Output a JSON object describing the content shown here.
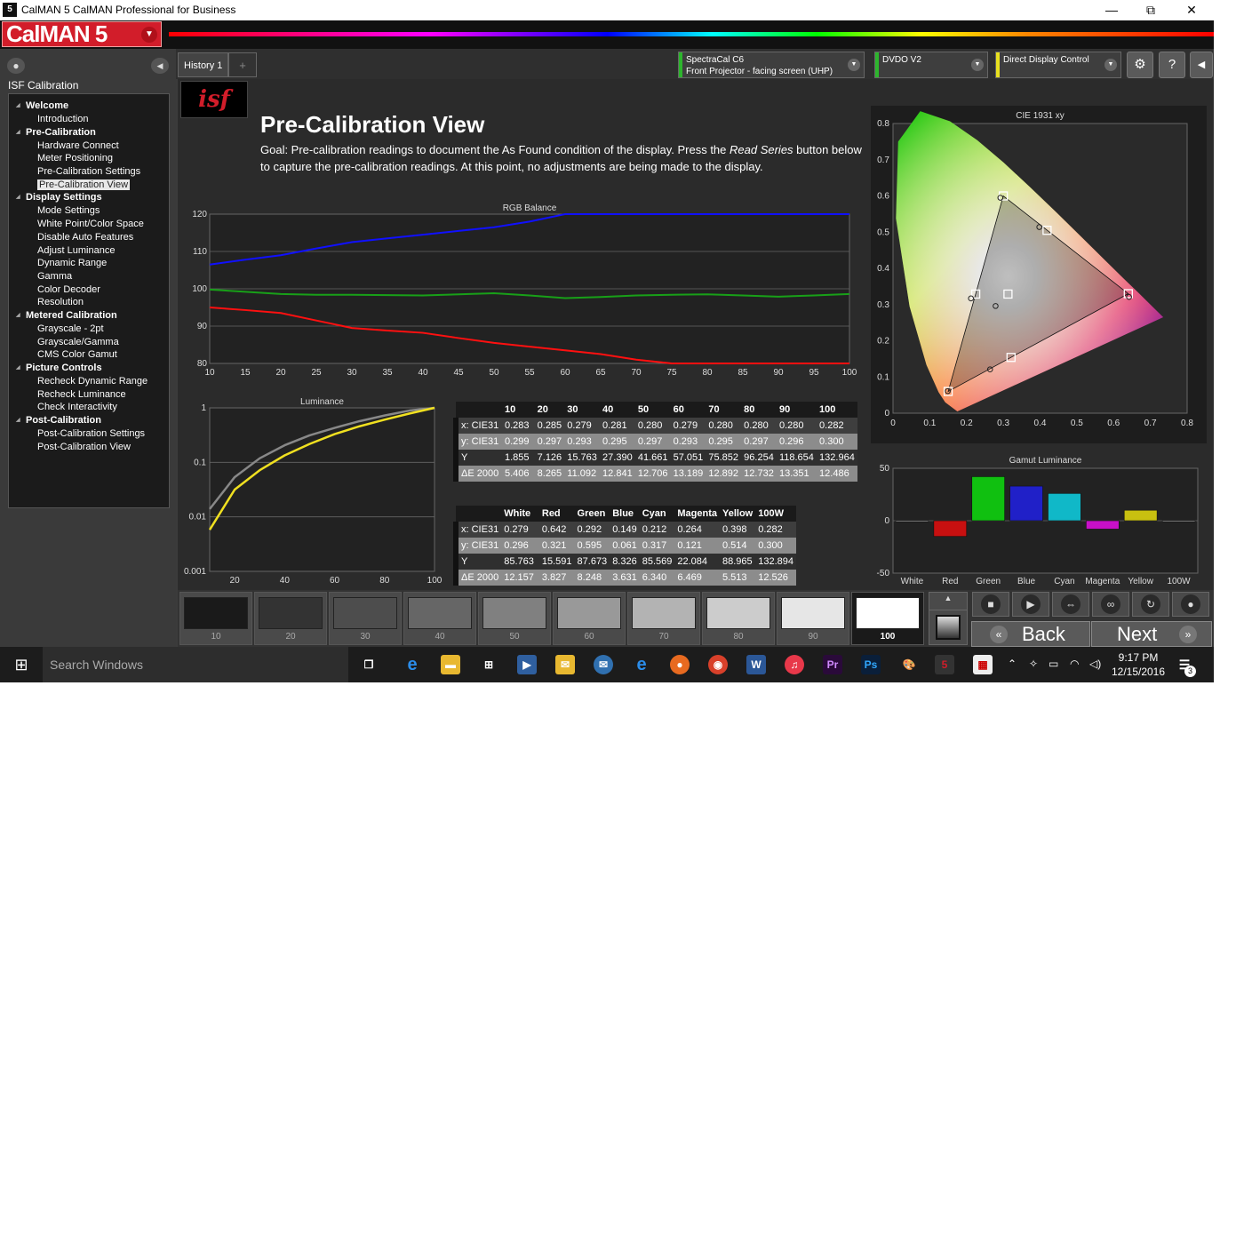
{
  "window": {
    "title": "CalMAN 5 CalMAN Professional for Business",
    "minimize": "—",
    "restore": "⧉",
    "close": "✕"
  },
  "brand": {
    "logo": "CalMAN 5"
  },
  "sidebar": {
    "workflow_title": "ISF Calibration",
    "groups": [
      {
        "label": "Welcome",
        "items": [
          "Introduction"
        ]
      },
      {
        "label": "Pre-Calibration",
        "items": [
          "Hardware Connect",
          "Meter Positioning",
          "Pre-Calibration Settings",
          "Pre-Calibration View"
        ]
      },
      {
        "label": "Display Settings",
        "items": [
          "Mode Settings",
          "White Point/Color Space",
          "Disable Auto Features",
          "Adjust Luminance",
          "Dynamic Range",
          "Gamma",
          "Color Decoder",
          "Resolution"
        ]
      },
      {
        "label": "Metered Calibration",
        "items": [
          "Grayscale - 2pt",
          "Grayscale/Gamma",
          "CMS Color Gamut"
        ]
      },
      {
        "label": "Picture Controls",
        "items": [
          "Recheck Dynamic Range",
          "Recheck Luminance",
          "Check Interactivity"
        ]
      },
      {
        "label": "Post-Calibration",
        "items": [
          "Post-Calibration Settings",
          "Post-Calibration View"
        ]
      }
    ],
    "selected": "Pre-Calibration View"
  },
  "tabs": {
    "history": "History 1",
    "add": "+"
  },
  "devices": {
    "meter": {
      "line1": "SpectraCal C6",
      "line2": "Front Projector - facing screen (UHP)",
      "color": "#2db52d"
    },
    "source": {
      "line1": "DVDO V2",
      "color": "#2db52d"
    },
    "display": {
      "line1": "Direct Display Control",
      "color": "#e8e020"
    }
  },
  "toolbar": {
    "settings": "⚙",
    "help": "?",
    "collapse": "◀"
  },
  "page": {
    "logo": "isf",
    "title": "Pre-Calibration View",
    "goal_before": "Goal: Pre-calibration readings to document the As Found condition of the display. Press the ",
    "goal_em": "Read Series",
    "goal_after": " button below to capture the pre-calibration readings. At this point, no adjustments are being made to the display."
  },
  "grayscale_table": {
    "headers": [
      "",
      "10",
      "20",
      "30",
      "40",
      "50",
      "60",
      "70",
      "80",
      "90",
      "100"
    ],
    "rows": [
      {
        "label": "x: CIE31",
        "values": [
          "0.283",
          "0.285",
          "0.279",
          "0.281",
          "0.280",
          "0.279",
          "0.280",
          "0.280",
          "0.280",
          "0.282"
        ]
      },
      {
        "label": "y: CIE31",
        "values": [
          "0.299",
          "0.297",
          "0.293",
          "0.295",
          "0.297",
          "0.293",
          "0.295",
          "0.297",
          "0.296",
          "0.300"
        ]
      },
      {
        "label": "Y",
        "values": [
          "1.855",
          "7.126",
          "15.763",
          "27.390",
          "41.661",
          "57.051",
          "75.852",
          "96.254",
          "118.654",
          "132.964"
        ]
      },
      {
        "label": "ΔE 2000",
        "values": [
          "5.406",
          "8.265",
          "11.092",
          "12.841",
          "12.706",
          "13.189",
          "12.892",
          "12.732",
          "13.351",
          "12.486"
        ]
      }
    ]
  },
  "color_table": {
    "headers": [
      "",
      "White",
      "Red",
      "Green",
      "Blue",
      "Cyan",
      "Magenta",
      "Yellow",
      "100W"
    ],
    "rows": [
      {
        "label": "x: CIE31",
        "values": [
          "0.279",
          "0.642",
          "0.292",
          "0.149",
          "0.212",
          "0.264",
          "0.398",
          "0.282"
        ]
      },
      {
        "label": "y: CIE31",
        "values": [
          "0.296",
          "0.321",
          "0.595",
          "0.061",
          "0.317",
          "0.121",
          "0.514",
          "0.300"
        ]
      },
      {
        "label": "Y",
        "values": [
          "85.763",
          "15.591",
          "87.673",
          "8.326",
          "85.569",
          "22.084",
          "88.965",
          "132.894"
        ]
      },
      {
        "label": "ΔE 2000",
        "values": [
          "12.157",
          "3.827",
          "8.248",
          "3.631",
          "6.340",
          "6.469",
          "5.513",
          "12.526"
        ]
      }
    ]
  },
  "chart_data": [
    {
      "type": "line",
      "title": "RGB Balance",
      "x": [
        10,
        15,
        20,
        25,
        30,
        35,
        40,
        45,
        50,
        55,
        60,
        65,
        70,
        75,
        80,
        85,
        90,
        95,
        100
      ],
      "xlim": [
        10,
        100
      ],
      "ylim": [
        80,
        120
      ],
      "yticks": [
        80,
        90,
        100,
        110,
        120
      ],
      "series": [
        {
          "color": "#1010ff",
          "values": [
            106.5,
            107.8,
            109,
            110.8,
            112.5,
            113.5,
            114.5,
            115.5,
            116.5,
            118,
            120,
            120,
            120,
            120,
            120,
            120,
            120,
            120,
            120
          ]
        },
        {
          "color": "#18a018",
          "values": [
            99.8,
            99.2,
            98.6,
            98.4,
            98.4,
            98.3,
            98.2,
            98.5,
            98.8,
            98.2,
            97.5,
            97.8,
            98.2,
            98.4,
            98.5,
            98.2,
            97.9,
            98.2,
            98.6
          ]
        },
        {
          "color": "#ff1010",
          "values": [
            95,
            94.3,
            93.5,
            91.5,
            89.5,
            88.8,
            88.2,
            86.8,
            85.5,
            84.5,
            83.5,
            82.5,
            81,
            80,
            80,
            80,
            80,
            80,
            80
          ]
        }
      ]
    },
    {
      "type": "line",
      "title": "Luminance",
      "scale": "log",
      "x": [
        10,
        20,
        30,
        40,
        50,
        60,
        70,
        80,
        90,
        100
      ],
      "xlim": [
        10,
        100
      ],
      "xticks": [
        20,
        40,
        60,
        80,
        100
      ],
      "ylim": [
        0.001,
        1
      ],
      "yticks": [
        "1",
        "0.1",
        "0.01",
        "0.001"
      ],
      "series": [
        {
          "color": "#888888",
          "values": [
            0.0139,
            0.0536,
            0.1185,
            0.206,
            0.313,
            0.429,
            0.57,
            0.724,
            0.892,
            1.0
          ]
        },
        {
          "color": "#f0e020",
          "values": [
            0.0058,
            0.0316,
            0.0716,
            0.1342,
            0.2176,
            0.3297,
            0.4591,
            0.6062,
            0.7875,
            1.0
          ]
        }
      ]
    },
    {
      "type": "scatter",
      "title": "CIE 1931 xy",
      "xlim": [
        0,
        0.8
      ],
      "ylim": [
        0,
        0.8
      ],
      "xticks": [
        "0",
        "0.1",
        "0.2",
        "0.3",
        "0.4",
        "0.5",
        "0.6",
        "0.7",
        "0.8"
      ],
      "yticks": [
        "0",
        "0.1",
        "0.2",
        "0.3",
        "0.4",
        "0.5",
        "0.6",
        "0.7",
        "0.8"
      ],
      "targets": [
        [
          0.64,
          0.33
        ],
        [
          0.3,
          0.6
        ],
        [
          0.15,
          0.06
        ],
        [
          0.225,
          0.329
        ],
        [
          0.321,
          0.154
        ],
        [
          0.419,
          0.505
        ],
        [
          0.3127,
          0.329
        ]
      ],
      "measured": [
        [
          0.642,
          0.321
        ],
        [
          0.292,
          0.595
        ],
        [
          0.149,
          0.061
        ],
        [
          0.212,
          0.317
        ],
        [
          0.264,
          0.121
        ],
        [
          0.398,
          0.514
        ],
        [
          0.279,
          0.296
        ]
      ]
    },
    {
      "type": "bar",
      "title": "Gamut Luminance",
      "categories": [
        "White",
        "Red",
        "Green",
        "Blue",
        "Cyan",
        "Magenta",
        "Yellow",
        "100W"
      ],
      "values": [
        0,
        -15,
        42,
        33,
        26,
        -8,
        10,
        0
      ],
      "ylim": [
        -50,
        50
      ],
      "yticks": [
        "50",
        "0",
        "-50"
      ],
      "colors": [
        "#ffffff",
        "#c81010",
        "#10c010",
        "#2020c8",
        "#10b8c8",
        "#c810c8",
        "#c8c010",
        "#ffffff"
      ]
    }
  ],
  "swatches": [
    {
      "label": "10",
      "color": "#1a1a1a"
    },
    {
      "label": "20",
      "color": "#333333"
    },
    {
      "label": "30",
      "color": "#4d4d4d"
    },
    {
      "label": "40",
      "color": "#666666"
    },
    {
      "label": "50",
      "color": "#808080"
    },
    {
      "label": "60",
      "color": "#999999"
    },
    {
      "label": "70",
      "color": "#b3b3b3"
    },
    {
      "label": "80",
      "color": "#cccccc"
    },
    {
      "label": "90",
      "color": "#e6e6e6"
    },
    {
      "label": "100",
      "color": "#ffffff"
    }
  ],
  "navigation": {
    "back": "Back",
    "next": "Next"
  },
  "taskbar": {
    "search_placeholder": "Search Windows",
    "time": "9:17 PM",
    "date": "12/15/2016",
    "notifications": "3"
  }
}
